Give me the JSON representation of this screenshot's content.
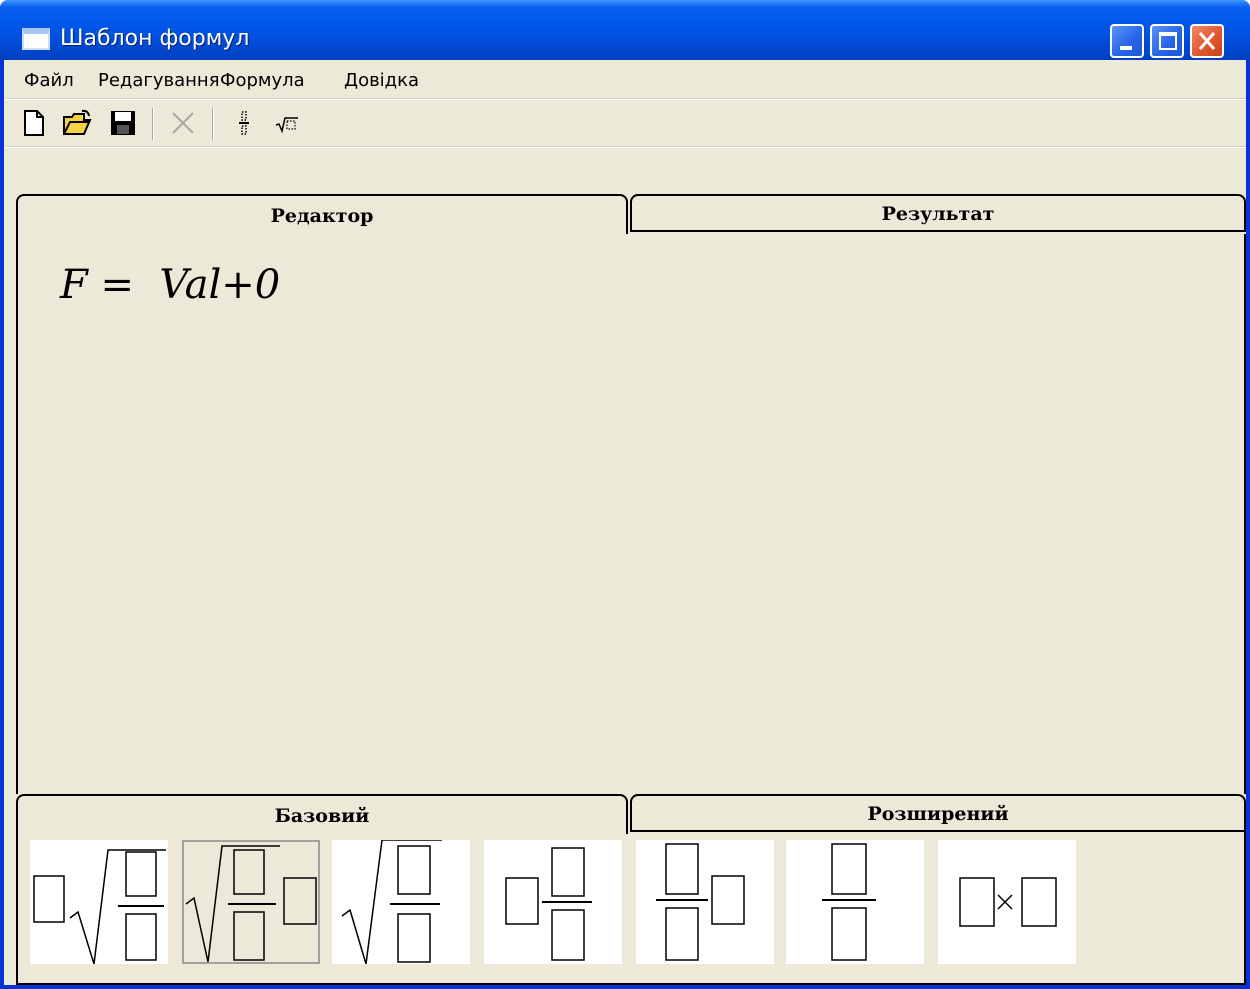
{
  "window": {
    "title": "Шаблон формул"
  },
  "titlebar_buttons": {
    "minimize": "minimize-button",
    "maximize": "maximize-button",
    "close": "close-button"
  },
  "menu": [
    "Файл",
    "Редагування",
    "Формула",
    "Довідка"
  ],
  "toolbar": {
    "icons": [
      "new-file-icon",
      "open-folder-icon",
      "save-disk-icon",
      "delete-x-icon",
      "fraction-icon",
      "sqrt-icon"
    ]
  },
  "top_tabs": {
    "active": "Редактор",
    "inactive": "Результат"
  },
  "editor": {
    "formula": "F =  Val+0"
  },
  "bottom_tabs": {
    "active": "Базовий",
    "inactive": "Розширений"
  },
  "templates": [
    "nth-root-fraction",
    "sqrt-fraction-box",
    "sqrt-fraction",
    "box-fraction",
    "fraction-box",
    "fraction",
    "box-times-box"
  ],
  "colors": {
    "titlebar": "#0055e5",
    "client_bg": "#ece9d8",
    "close": "#e0542d"
  }
}
